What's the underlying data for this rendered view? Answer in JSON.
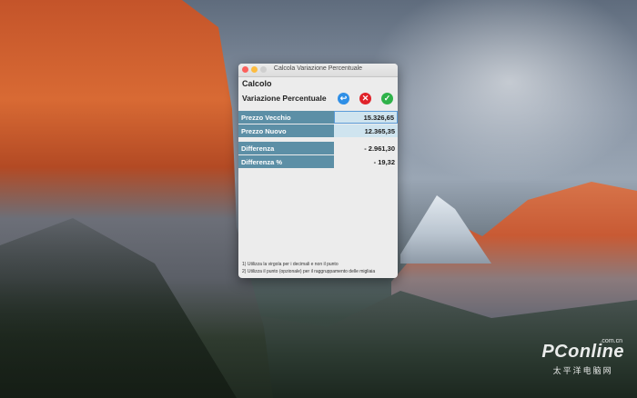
{
  "window": {
    "title": "Calcola Variazione Percentuale"
  },
  "header": {
    "line1": "Calcolo",
    "line2": "Variazione Percentuale"
  },
  "buttons": {
    "back_icon": "back-arrow-icon",
    "cancel_icon": "close-icon",
    "ok_icon": "checkmark-icon",
    "back_glyph": "↩",
    "cancel_glyph": "✕",
    "ok_glyph": "✓"
  },
  "inputs": [
    {
      "label": "Prezzo Vecchio",
      "value": "15.326,65"
    },
    {
      "label": "Prezzo Nuovo",
      "value": "12.365,35"
    }
  ],
  "results": [
    {
      "label": "Differenza",
      "value": "- 2.961,30"
    },
    {
      "label": "Differenza %",
      "value": "- 19,32"
    }
  ],
  "notes": [
    "1) Utilizza la virgola per i decimali e non il punto",
    "2) Utilizza il punto (opzionale) per il raggruppamento delle migliaia"
  ],
  "watermark": {
    "main": "PConline",
    "sub": "太平洋电脑网",
    "small": ".com.cn"
  },
  "colors": {
    "label_bg": "#5c8fa6",
    "input_bg": "#cfe4ef",
    "back": "#2f8fe6",
    "cancel": "#e0232a",
    "ok": "#2fb24a"
  }
}
